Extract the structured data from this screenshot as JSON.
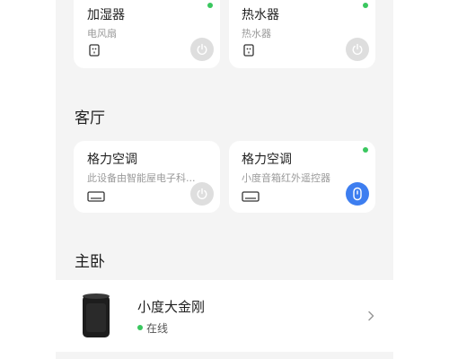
{
  "cards_top": [
    {
      "title": "加湿器",
      "subtitle": "电风扇",
      "online": true,
      "power_active": false
    },
    {
      "title": "热水器",
      "subtitle": "热水器",
      "online": true,
      "power_active": false
    }
  ],
  "living_room": {
    "title": "客厅",
    "cards": [
      {
        "title": "格力空调",
        "subtitle": "此设备由智能屋电子科...",
        "online": false,
        "power_active": false
      },
      {
        "title": "格力空调",
        "subtitle": "小度音箱红外遥控器",
        "online": true,
        "power_active": true
      }
    ]
  },
  "bedroom": {
    "title": "主卧",
    "speaker": {
      "name": "小度大金刚",
      "status": "在线"
    }
  },
  "colors": {
    "online": "#3ac75f",
    "active": "#3d7ef0",
    "background": "#f4f4f4"
  }
}
